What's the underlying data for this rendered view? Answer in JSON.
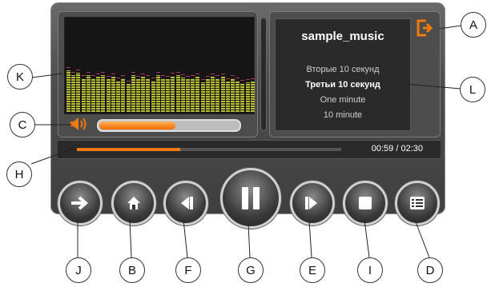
{
  "colors": {
    "accent": "#f07a10",
    "eq_bar": "#b8bd3a",
    "peak": "#b5355e"
  },
  "track": {
    "title": "sample_music",
    "lines": [
      "Вторые 10 секунд",
      "Третьи 10 секунд",
      "One minute",
      "10 minute"
    ],
    "current_line": 1
  },
  "playback": {
    "time": "00:59 / 02:30",
    "progress": 0.39,
    "volume": 0.55
  },
  "equalizer": {
    "levels": [
      0.45,
      0.4,
      0.42,
      0.36,
      0.4,
      0.36,
      0.38,
      0.4,
      0.35,
      0.38,
      0.34,
      0.36,
      0.3,
      0.4,
      0.35,
      0.38,
      0.36,
      0.34,
      0.4,
      0.36,
      0.35,
      0.39,
      0.4,
      0.37,
      0.35,
      0.36,
      0.38,
      0.32,
      0.35,
      0.38,
      0.36,
      0.38,
      0.33,
      0.36,
      0.34,
      0.31,
      0.32,
      0.33
    ]
  },
  "icons": {
    "exit": "exit-icon",
    "volume": "speaker-icon",
    "next": "arrow-right-icon",
    "home": "home-icon",
    "prev": "previous-icon",
    "pause": "pause-icon",
    "forward": "next-icon",
    "stop": "stop-icon",
    "list": "playlist-icon"
  },
  "callouts": {
    "A": "A",
    "B": "B",
    "C": "C",
    "D": "D",
    "E": "E",
    "F": "F",
    "G": "G",
    "H": "H",
    "I": "I",
    "J": "J",
    "K": "K",
    "L": "L"
  }
}
